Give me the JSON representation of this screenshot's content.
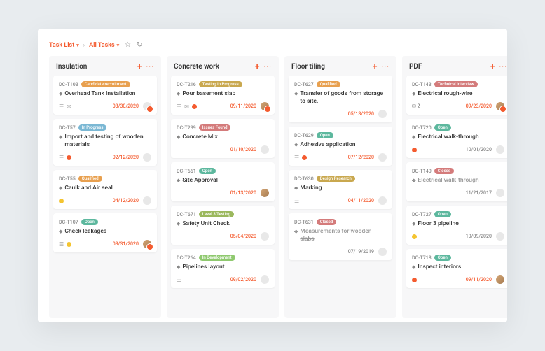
{
  "breadcrumb": {
    "list": "Task List",
    "filter": "All Tasks"
  },
  "badges": {
    "candidate": {
      "label": "Candidate recruitment",
      "color": "#e8a04f"
    },
    "inprogress": {
      "label": "In Progress",
      "color": "#7bb8d4"
    },
    "qualified": {
      "label": "Qualified",
      "color": "#e8a04f"
    },
    "open": {
      "label": "Open",
      "color": "#5db89e"
    },
    "testing": {
      "label": "Testing in Progress",
      "color": "#c9a84f"
    },
    "issues": {
      "label": "Issues Found",
      "color": "#d47b7b"
    },
    "lvl3": {
      "label": "Level 3 Testing",
      "color": "#9bb85d"
    },
    "indev": {
      "label": "In Development",
      "color": "#8fc96f"
    },
    "design": {
      "label": "Design Research",
      "color": "#c9a84f"
    },
    "closed": {
      "label": "Closed",
      "color": "#d47b7b"
    },
    "tech": {
      "label": "Technical Interview",
      "color": "#d47b7b"
    }
  },
  "columns": [
    {
      "title": "Insulation",
      "cards": [
        {
          "id": "DC-T103",
          "badge": "candidate",
          "title": "Overhead Tank Installation",
          "date": "03/30/2020",
          "icons": [
            "list",
            "chat"
          ],
          "avatar": "empty",
          "corner": true
        },
        {
          "id": "DC-T57",
          "badge": "inprogress",
          "title": "Import and testing of wooden materials",
          "date": "02/12/2020",
          "icons": [
            "list"
          ],
          "dot": "#f45b2f",
          "avatar": "empty"
        },
        {
          "id": "DC-T55",
          "badge": "qualified",
          "title": "Caulk and Air seal",
          "date": "04/12/2020",
          "dot": "#f4c430",
          "avatar": "empty"
        },
        {
          "id": "DC-T107",
          "badge": "open",
          "title": "Check leakages",
          "date": "03/31/2020",
          "icons": [
            "list"
          ],
          "dot": "#f4c430",
          "avatar": "img",
          "corner": true
        }
      ]
    },
    {
      "title": "Concrete work",
      "cards": [
        {
          "id": "DC-T216",
          "badge": "testing",
          "title": "Pour basement slab",
          "date": "09/11/2020",
          "icons": [
            "list",
            "chat"
          ],
          "dot": "#f45b2f",
          "avatar": "img",
          "corner": true
        },
        {
          "id": "DC-T239",
          "badge": "issues",
          "title": "Concrete Mix",
          "date": "01/10/2020",
          "avatar": "empty"
        },
        {
          "id": "DC-T661",
          "badge": "open",
          "title": "Site Approval",
          "date": "01/13/2020",
          "avatar": "img"
        },
        {
          "id": "DC-T671",
          "badge": "lvl3",
          "title": "Safety Unit Check",
          "date": "05/04/2020",
          "avatar": "empty"
        },
        {
          "id": "DC-T264",
          "badge": "indev",
          "title": "Pipelines layout",
          "date": "09/02/2020",
          "icons": [
            "list"
          ],
          "avatar": "empty"
        }
      ]
    },
    {
      "title": "Floor tiling",
      "cards": [
        {
          "id": "DC-T627",
          "badge": "qualified",
          "title": "Transfer of goods from storage to site.",
          "date": "05/13/2020",
          "avatar": "empty"
        },
        {
          "id": "DC-T629",
          "badge": "open",
          "title": "Adhesive application",
          "date": "07/12/2020",
          "icons": [
            "list"
          ],
          "dot": "#f45b2f",
          "avatar": "empty"
        },
        {
          "id": "DC-T630",
          "badge": "design",
          "title": "Marking",
          "date": "04/11/2020",
          "icons": [
            "list"
          ],
          "avatar": "empty"
        },
        {
          "id": "DC-T631",
          "badge": "closed",
          "title": "Measurements for wooden slabs",
          "strike": true,
          "date": "07/19/2019",
          "dateGray": true,
          "avatar": "empty"
        }
      ]
    },
    {
      "title": "PDF",
      "cards": [
        {
          "id": "DC-T143",
          "badge": "tech",
          "title": "Electrical rough-wire",
          "date": "09/23/2020",
          "count": "2",
          "avatar": "img",
          "corner": true
        },
        {
          "id": "DC-T720",
          "badge": "open",
          "title": "Electrical walk-through",
          "date": "10/01/2020",
          "dateGray": true,
          "dot": "#f45b2f",
          "avatar": "empty"
        },
        {
          "id": "DC-T140",
          "badge": "closed",
          "title": "Electrical walk-through",
          "strike": true,
          "date": "11/21/2017",
          "dateGray": true,
          "avatar": "empty"
        },
        {
          "id": "DC-T727",
          "badge": "open",
          "title": "Floor 3 pipeline",
          "date": "10/09/2020",
          "dateGray": true,
          "dot": "#f4c430",
          "avatar": "empty"
        },
        {
          "id": "DC-T718",
          "badge": "open",
          "title": "Inspect interiors",
          "date": "09/11/2020",
          "dot": "#f45b2f",
          "avatar": "img"
        }
      ]
    }
  ]
}
